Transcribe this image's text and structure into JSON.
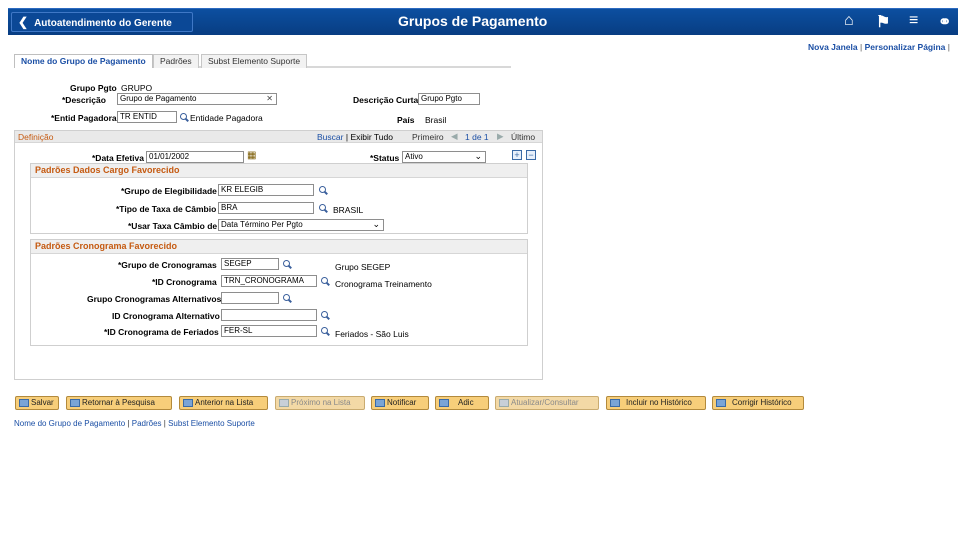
{
  "header": {
    "back_label": "Autoatendimento do Gerente",
    "title": "Grupos de Pagamento",
    "icons": [
      "home-icon",
      "flag-icon",
      "menu-icon",
      "compass-icon"
    ]
  },
  "toplinks": {
    "new_window": "Nova Janela",
    "personalize": "Personalizar Página"
  },
  "tabs": [
    "Nome do Grupo de Pagamento",
    "Padrões",
    "Subst Elemento Suporte"
  ],
  "form": {
    "grupo_pgto_label": "Grupo Pgto",
    "grupo_pgto_value": "GRUPO",
    "descricao_label": "*Descrição",
    "descricao_value": "Grupo de Pagamento",
    "descricao_curta_label": "Descrição Curta",
    "descricao_curta_value": "Grupo Pgto",
    "entid_label": "*Entid Pagadora",
    "entid_value": "TR ENTID",
    "entid_desc": "Entidade Pagadora",
    "pais_label": "País",
    "pais_value": "Brasil"
  },
  "definicao": {
    "title": "Definição",
    "find": "Buscar",
    "view_all": "Exibir Tudo",
    "first": "Primeiro",
    "page": "1 de 1",
    "last": "Último",
    "data_efetiva_label": "*Data Efetiva",
    "data_efetiva_value": "01/01/2002",
    "status_label": "*Status",
    "status_value": "Ativo"
  },
  "cargo": {
    "title": "Padrões Dados Cargo Favorecido",
    "elegibilidade_label": "*Grupo de Elegibilidade",
    "elegibilidade_value": "KR ELEGIB",
    "taxa_label": "*Tipo de Taxa de Câmbio",
    "taxa_value": "BRA",
    "taxa_desc": "BRASIL",
    "usar_label": "*Usar Taxa Câmbio de",
    "usar_value": "Data Término Per Pgto"
  },
  "cronograma": {
    "title": "Padrões Cronograma Favorecido",
    "grupo_label": "*Grupo de Cronogramas",
    "grupo_value": "SEGEP",
    "grupo_desc": "Grupo SEGEP",
    "id_label": "*ID Cronograma",
    "id_value": "TRN_CRONOGRAMA",
    "id_desc": "Cronograma Treinamento",
    "alt_grupo_label": "Grupo Cronogramas Alternativos",
    "alt_grupo_value": "",
    "alt_id_label": "ID Cronograma Alternativo",
    "alt_id_value": "",
    "feriados_label": "*ID Cronograma de Feriados",
    "feriados_value": "FER-SL",
    "feriados_desc": "Feriados - São Luis"
  },
  "toolbar": {
    "salvar": "Salvar",
    "retornar": "Retornar à Pesquisa",
    "anterior": "Anterior na Lista",
    "proximo": "Próximo na Lista",
    "notificar": "Notificar",
    "adic": "Adic",
    "atualizar": "Atualizar/Consultar",
    "incluir": "Incluir no Histórico",
    "corrigir": "Corrigir Histórico"
  },
  "bottomlinks": [
    "Nome do Grupo de Pagamento",
    "Padrões",
    "Subst Elemento Suporte"
  ]
}
